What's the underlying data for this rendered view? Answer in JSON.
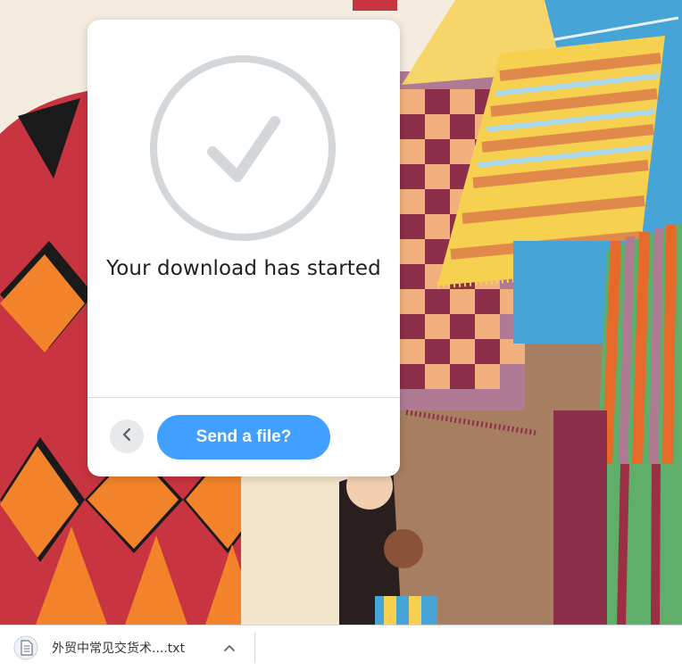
{
  "dialog": {
    "title": "Your download has started",
    "send_button_label": "Send a file?",
    "back_button_icon": "chevron-left-icon",
    "status_icon": "checkmark-circle-icon"
  },
  "download_bar": {
    "items": [
      {
        "file_name": "外贸中常见交货术....txt",
        "icon": "text-file-icon"
      }
    ],
    "menu_icon": "chevron-up-icon"
  },
  "colors": {
    "accent": "#409fff",
    "check_gray": "#d4d7da",
    "back_button_bg": "#e7e9eb"
  }
}
